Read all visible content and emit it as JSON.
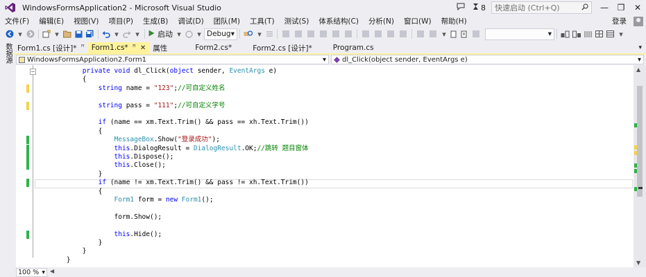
{
  "window": {
    "title": "WindowsFormsApplication2 - Microsoft Visual Studio",
    "notifications_count": "8",
    "quick_launch_placeholder": "快速启动 (Ctrl+Q)",
    "minimize": "—",
    "restore": "❐",
    "close": "✕"
  },
  "menu": {
    "items": [
      "文件(F)",
      "编辑(E)",
      "视图(V)",
      "项目(P)",
      "生成(B)",
      "调试(D)",
      "团队(M)",
      "工具(T)",
      "测试(S)",
      "体系结构(C)",
      "分析(N)",
      "窗口(W)",
      "帮助(H)"
    ],
    "login": "登录"
  },
  "toolbar": {
    "start_label": "启动",
    "config_value": "Debug"
  },
  "side_panel": {
    "label": "数据源"
  },
  "tabs": [
    {
      "label": "Form1.cs [设计]*",
      "pin": "ꟸ",
      "active": false
    },
    {
      "label": "Form1.cs*",
      "pin": "ꟸ",
      "close": "✕",
      "active": true
    },
    {
      "label": "属性",
      "active": false
    },
    {
      "label": "Form2.cs*",
      "active": false
    },
    {
      "label": "Form2.cs [设计]*",
      "active": false
    },
    {
      "label": "Program.cs",
      "active": false
    }
  ],
  "navbar": {
    "class_value": "WindowsFormsApplication2.Form1",
    "member_value": "dl_Click(object sender, EventArgs e)"
  },
  "editor": {
    "zoom": "100 %",
    "lines": [
      {
        "parts": [
          [
            "        ",
            "tx"
          ],
          [
            "private",
            "kw"
          ],
          [
            " ",
            "tx"
          ],
          [
            "void",
            "kw"
          ],
          [
            " dl_Click(",
            "tx"
          ],
          [
            "object",
            "kw"
          ],
          [
            " sender, ",
            "tx"
          ],
          [
            "EventArgs",
            "ty"
          ],
          [
            " e)",
            "tx"
          ]
        ],
        "mark": ""
      },
      {
        "parts": [
          [
            "        {",
            "tx"
          ]
        ],
        "mark": ""
      },
      {
        "parts": [
          [
            "            ",
            "tx"
          ],
          [
            "string",
            "kw"
          ],
          [
            " name = ",
            "tx"
          ],
          [
            "\"123\"",
            "str"
          ],
          [
            ";",
            "tx"
          ],
          [
            "//可自定义姓名",
            "cm"
          ]
        ],
        "mark": "yellow"
      },
      {
        "parts": [
          [
            "",
            "tx"
          ]
        ],
        "mark": ""
      },
      {
        "parts": [
          [
            "            ",
            "tx"
          ],
          [
            "string",
            "kw"
          ],
          [
            " pass = ",
            "tx"
          ],
          [
            "\"111\"",
            "str"
          ],
          [
            ";",
            "tx"
          ],
          [
            "//可自定义学号",
            "cm"
          ]
        ],
        "mark": "yellow"
      },
      {
        "parts": [
          [
            "",
            "tx"
          ]
        ],
        "mark": ""
      },
      {
        "parts": [
          [
            "            ",
            "tx"
          ],
          [
            "if",
            "kw"
          ],
          [
            " (name == xm.Text.Trim() && pass == xh.Text.Trim())",
            "tx"
          ]
        ],
        "mark": ""
      },
      {
        "parts": [
          [
            "            {",
            "tx"
          ]
        ],
        "mark": ""
      },
      {
        "parts": [
          [
            "                ",
            "tx"
          ],
          [
            "MessageBox",
            "ty"
          ],
          [
            ".Show(",
            "tx"
          ],
          [
            "\"登录成功\"",
            "str"
          ],
          [
            ");",
            "tx"
          ]
        ],
        "mark": "green"
      },
      {
        "parts": [
          [
            "                ",
            "tx"
          ],
          [
            "this",
            "kw"
          ],
          [
            ".DialogResult = ",
            "tx"
          ],
          [
            "DialogResult",
            "ty"
          ],
          [
            ".OK;",
            "tx"
          ],
          [
            "//跳转 题目窗体",
            "cm"
          ]
        ],
        "mark": "green"
      },
      {
        "parts": [
          [
            "                ",
            "tx"
          ],
          [
            "this",
            "kw"
          ],
          [
            ".Dispose();",
            "tx"
          ]
        ],
        "mark": "green"
      },
      {
        "parts": [
          [
            "                ",
            "tx"
          ],
          [
            "this",
            "kw"
          ],
          [
            ".Close();",
            "tx"
          ]
        ],
        "mark": "green"
      },
      {
        "parts": [
          [
            "            }",
            "tx"
          ]
        ],
        "mark": ""
      },
      {
        "parts": [
          [
            "            ",
            "tx"
          ],
          [
            "if",
            "kw"
          ],
          [
            " (name != xm.Text.Trim() && pass != xh.Text.Trim())",
            "tx"
          ]
        ],
        "mark": "green"
      },
      {
        "parts": [
          [
            "            {",
            "tx"
          ]
        ],
        "mark": ""
      },
      {
        "parts": [
          [
            "                ",
            "tx"
          ],
          [
            "Form1",
            "ty"
          ],
          [
            " form = ",
            "tx"
          ],
          [
            "new",
            "kw"
          ],
          [
            " ",
            "tx"
          ],
          [
            "Form1",
            "ty"
          ],
          [
            "();",
            "tx"
          ]
        ],
        "mark": ""
      },
      {
        "parts": [
          [
            "",
            "tx"
          ]
        ],
        "mark": ""
      },
      {
        "parts": [
          [
            "                form.Show();",
            "tx"
          ]
        ],
        "mark": ""
      },
      {
        "parts": [
          [
            "",
            "tx"
          ]
        ],
        "mark": ""
      },
      {
        "parts": [
          [
            "                ",
            "tx"
          ],
          [
            "this",
            "kw"
          ],
          [
            ".Hide();",
            "tx"
          ]
        ],
        "mark": "green"
      },
      {
        "parts": [
          [
            "            }",
            "tx"
          ]
        ],
        "mark": ""
      },
      {
        "parts": [
          [
            "        }",
            "tx"
          ]
        ],
        "mark": ""
      },
      {
        "parts": [
          [
            "    }",
            "tx"
          ]
        ],
        "mark": ""
      }
    ]
  }
}
